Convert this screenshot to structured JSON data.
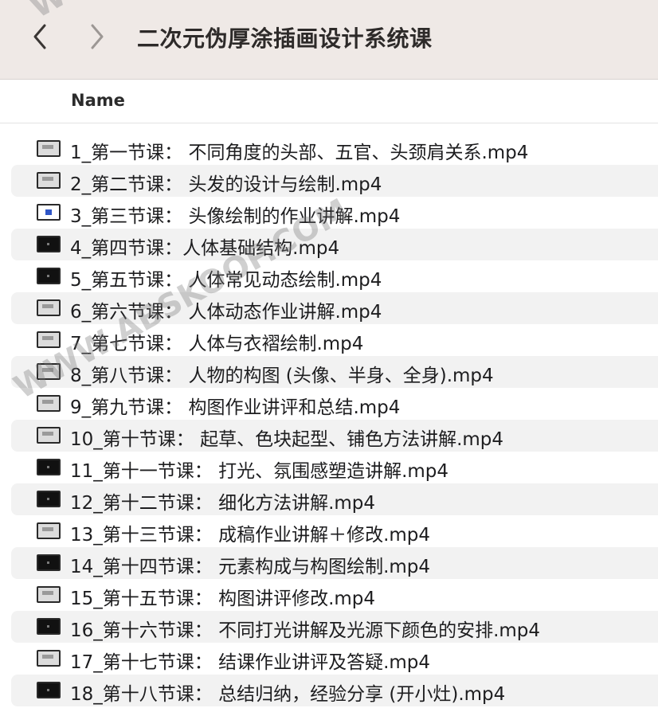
{
  "toolbar": {
    "title": "二次元伪厚涂插画设计系统课",
    "back_icon": "chevron-left-icon",
    "forward_icon": "chevron-right-icon"
  },
  "columns": {
    "name_label": "Name"
  },
  "files": [
    {
      "name": "1_第一节课： 不同角度的头部、五官、头颈肩关系.mp4",
      "thumb": "light"
    },
    {
      "name": "2_第二节课： 头发的设计与绘制.mp4",
      "thumb": "light"
    },
    {
      "name": "3_第三节课： 头像绘制的作业讲解.mp4",
      "thumb": "blue"
    },
    {
      "name": "4_第四节课：人体基础结构.mp4",
      "thumb": "dark"
    },
    {
      "name": "5_第五节课： 人体常见动态绘制.mp4",
      "thumb": "dark"
    },
    {
      "name": "6_第六节课： 人体动态作业讲解.mp4",
      "thumb": "light"
    },
    {
      "name": "7_第七节课： 人体与衣褶绘制.mp4",
      "thumb": "light"
    },
    {
      "name": "8_第八节课： 人物的构图 (头像、半身、全身).mp4",
      "thumb": "light"
    },
    {
      "name": "9_第九节课： 构图作业讲评和总结.mp4",
      "thumb": "light"
    },
    {
      "name": "10_第十节课： 起草、色块起型、铺色方法讲解.mp4",
      "thumb": "light"
    },
    {
      "name": "11_第十一节课： 打光、氛围感塑造讲解.mp4",
      "thumb": "dark"
    },
    {
      "name": "12_第十二节课： 细化方法讲解.mp4",
      "thumb": "dark"
    },
    {
      "name": "13_第十三节课： 成稿作业讲解＋修改.mp4",
      "thumb": "light"
    },
    {
      "name": "14_第十四节课： 元素构成与构图绘制.mp4",
      "thumb": "dark"
    },
    {
      "name": "15_第十五节课： 构图讲评修改.mp4",
      "thumb": "light"
    },
    {
      "name": "16_第十六节课： 不同打光讲解及光源下颜色的安排.mp4",
      "thumb": "dark"
    },
    {
      "name": "17_第十七节课： 结课作业讲评及答疑.mp4",
      "thumb": "light"
    },
    {
      "name": "18_第十八节课： 总结归纳，经验分享 (开小灶).mp4",
      "thumb": "dark"
    }
  ],
  "watermark": {
    "main": "WWW.ABSKOOP.COM",
    "top": "WW"
  }
}
